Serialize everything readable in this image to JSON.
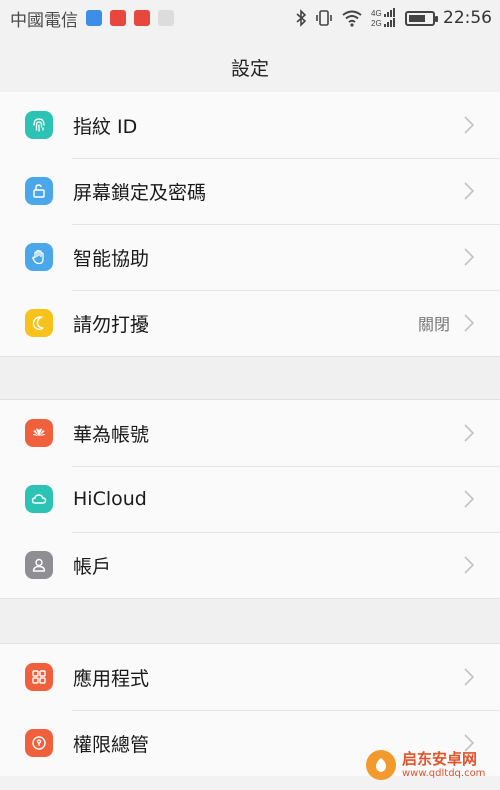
{
  "statusbar": {
    "carrier": "中國電信",
    "time": "22:56",
    "network_4g": "4G",
    "network_2g": "2G"
  },
  "header": {
    "title": "設定"
  },
  "sections": [
    {
      "items": [
        {
          "label": "指紋 ID",
          "icon": "fingerprint-icon",
          "color": "#2cc3b5"
        },
        {
          "label": "屏幕鎖定及密碼",
          "icon": "lock-icon",
          "color": "#4aa7ea"
        },
        {
          "label": "智能協助",
          "icon": "hand-icon",
          "color": "#4aa7ea"
        },
        {
          "label": "請勿打擾",
          "icon": "moon-icon",
          "color": "#f7c21a",
          "value": "關閉"
        }
      ]
    },
    {
      "items": [
        {
          "label": "華為帳號",
          "icon": "huawei-icon",
          "color": "#f0603c"
        },
        {
          "label": "HiCloud",
          "icon": "cloud-icon",
          "color": "#2cc3b5"
        },
        {
          "label": "帳戶",
          "icon": "user-icon",
          "color": "#8e8e93"
        }
      ]
    },
    {
      "items": [
        {
          "label": "應用程式",
          "icon": "apps-icon",
          "color": "#f0603c"
        },
        {
          "label": "權限總管",
          "icon": "permission-icon",
          "color": "#f0603c"
        }
      ]
    }
  ],
  "watermark": {
    "title": "启东安卓网",
    "url": "www.qdltdq.com"
  }
}
